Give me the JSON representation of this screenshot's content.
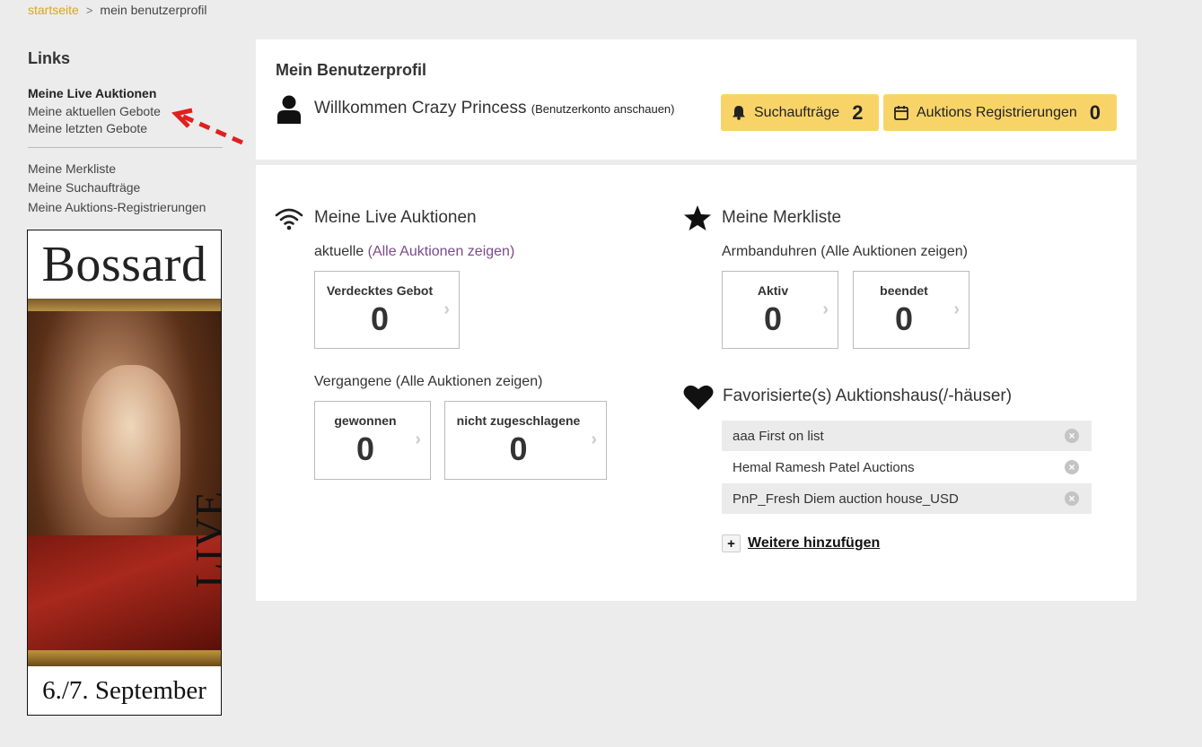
{
  "breadcrumb": {
    "home": "startseite",
    "separator": ">",
    "current": "mein benutzerprofil"
  },
  "sidebar": {
    "title": "Links",
    "group1": [
      {
        "label": "Meine Live Auktionen",
        "active": true
      },
      {
        "label": "Meine aktuellen Gebote"
      },
      {
        "label": "Meine letzten Gebote"
      }
    ],
    "group2": [
      {
        "label": "Meine Merkliste"
      },
      {
        "label": "Meine Suchaufträge"
      },
      {
        "label": "Meine Auktions-Registrierungen"
      }
    ]
  },
  "banner": {
    "brand": "Bossard",
    "live": "LIVE",
    "date": "6./7. September"
  },
  "profile": {
    "title": "Mein Benutzerprofil",
    "welcome": "Willkommen Crazy Princess",
    "account_link": "(Benutzerkonto anschauen)",
    "search_orders": {
      "label": "Suchaufträge",
      "count": "2"
    },
    "registrations": {
      "label": "Auktions Registrierungen",
      "count": "0"
    }
  },
  "live": {
    "title": "Meine Live Auktionen",
    "current_label": "aktuelle",
    "current_link": "(Alle Auktionen zeigen)",
    "hidden_bid": {
      "label": "Verdecktes Gebot",
      "value": "0"
    },
    "past_label": "Vergangene",
    "past_link": "(Alle Auktionen zeigen)",
    "won": {
      "label": "gewonnen",
      "value": "0"
    },
    "not_awarded": {
      "label": "nicht zugeschlagene",
      "value": "0"
    }
  },
  "watchlist": {
    "title": "Meine Merkliste",
    "category_label": "Armbanduhren",
    "category_link": "(Alle Auktionen zeigen)",
    "active": {
      "label": "Aktiv",
      "value": "0"
    },
    "ended": {
      "label": "beendet",
      "value": "0"
    }
  },
  "favorites": {
    "title": "Favorisierte(s) Auktionshaus(/-häuser)",
    "items": [
      {
        "name": "aaa First on list"
      },
      {
        "name": "Hemal Ramesh Patel Auctions"
      },
      {
        "name": "PnP_Fresh Diem auction house_USD"
      }
    ],
    "add_more": "Weitere hinzufügen",
    "add_icon": "+"
  },
  "colors": {
    "accent_yellow": "#f8d468",
    "link_gold": "#d9a520",
    "link_purple": "#7b4a8c",
    "arrow_red": "#e02020"
  }
}
